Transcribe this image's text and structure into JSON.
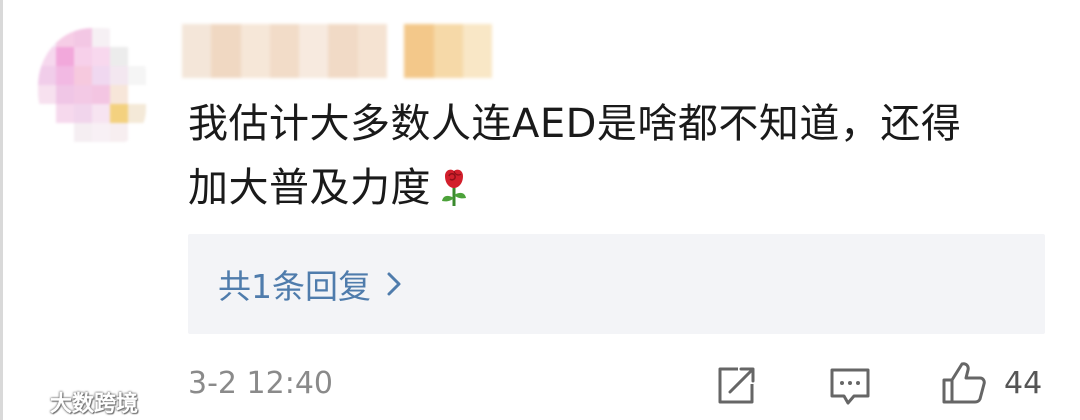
{
  "comment": {
    "line1": "我估计大多数人连AED是啥都不知道，还得",
    "line2": "加大普及力度",
    "emoji": "rose-emoji"
  },
  "replies": {
    "label": "共1条回复",
    "icon": "chevron-right-icon"
  },
  "footer": {
    "time": "3-2 12:40",
    "like_count": "44"
  },
  "watermark": {
    "text": "大数跨境"
  },
  "colors": {
    "reply_link": "#4f7cac",
    "reply_bg": "#f3f4f7",
    "meta_text": "#8a8a8a"
  }
}
